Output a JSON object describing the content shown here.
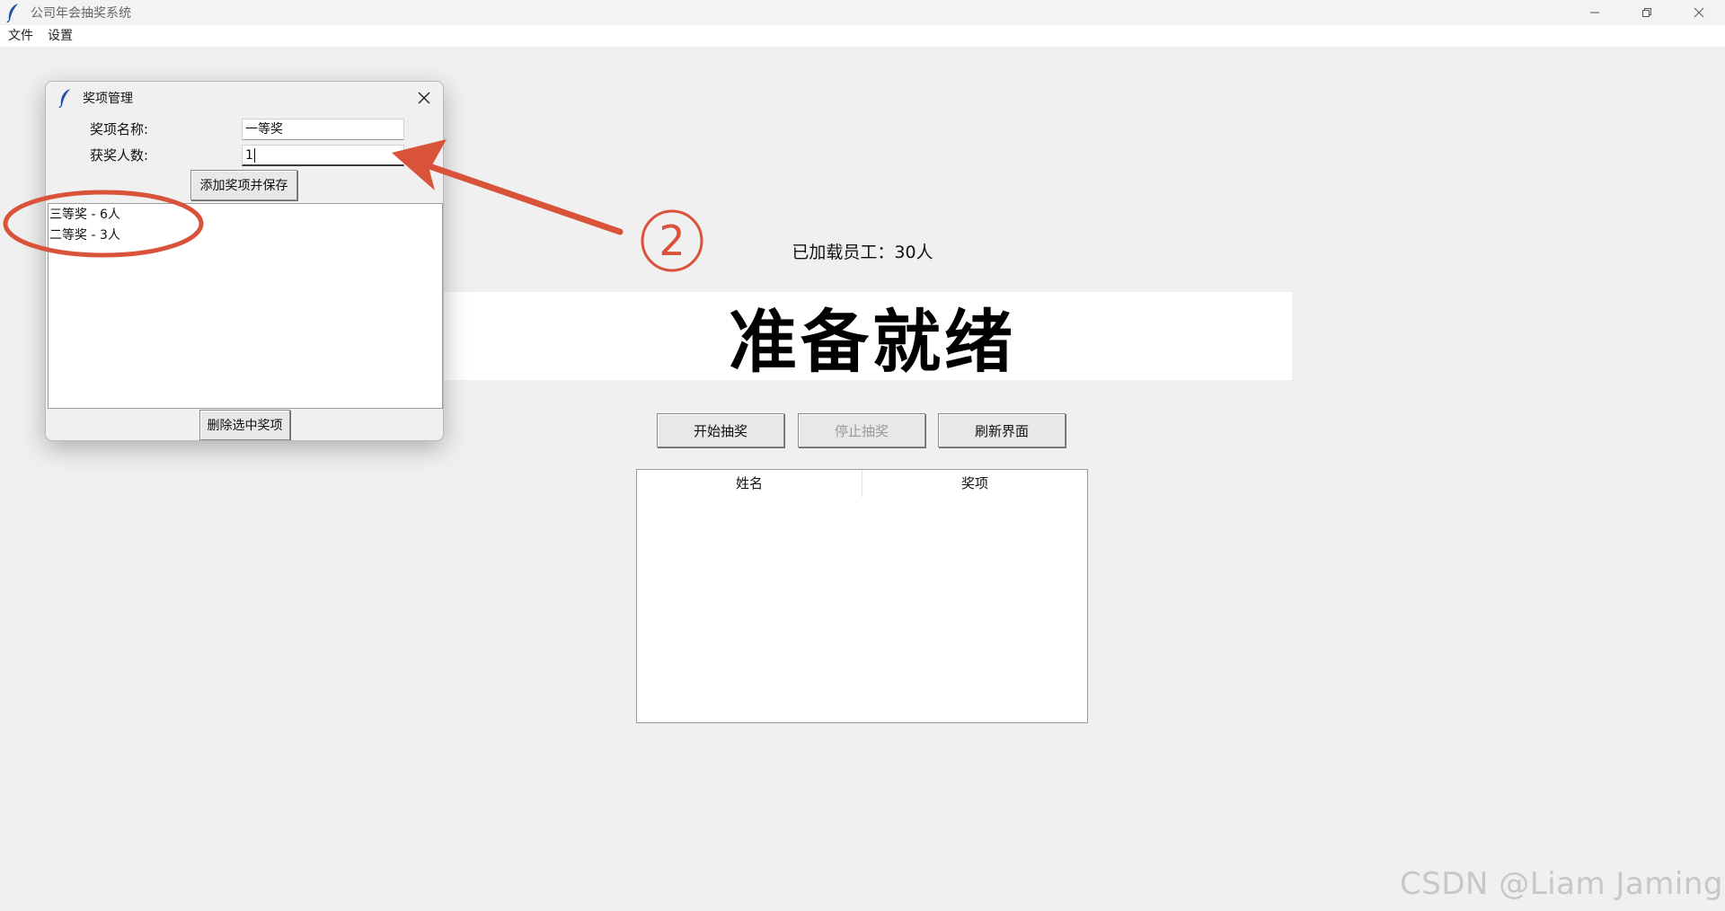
{
  "window": {
    "title": "公司年会抽奖系统"
  },
  "menu": {
    "items": [
      "文件",
      "设置"
    ]
  },
  "main": {
    "loaded_text": "已加载员工：30人",
    "status_text": "准备就绪",
    "buttons": {
      "start": "开始抽奖",
      "stop": "停止抽奖",
      "refresh": "刷新界面"
    },
    "table": {
      "columns": [
        "姓名",
        "奖项"
      ],
      "rows": []
    }
  },
  "dialog": {
    "title": "奖项管理",
    "name_label": "奖项名称:",
    "name_value": "一等奖",
    "count_label": "获奖人数:",
    "count_value": "1",
    "add_button": "添加奖项并保存",
    "list": [
      "三等奖 - 6人",
      "二等奖 - 3人"
    ],
    "delete_button": "删除选中奖项"
  },
  "annotation": {
    "step_marker": "②",
    "color": "#d9533b"
  },
  "watermark": "CSDN @Liam Jaming",
  "icons": [
    "feather-icon",
    "minimize-icon",
    "restore-icon",
    "close-icon"
  ]
}
